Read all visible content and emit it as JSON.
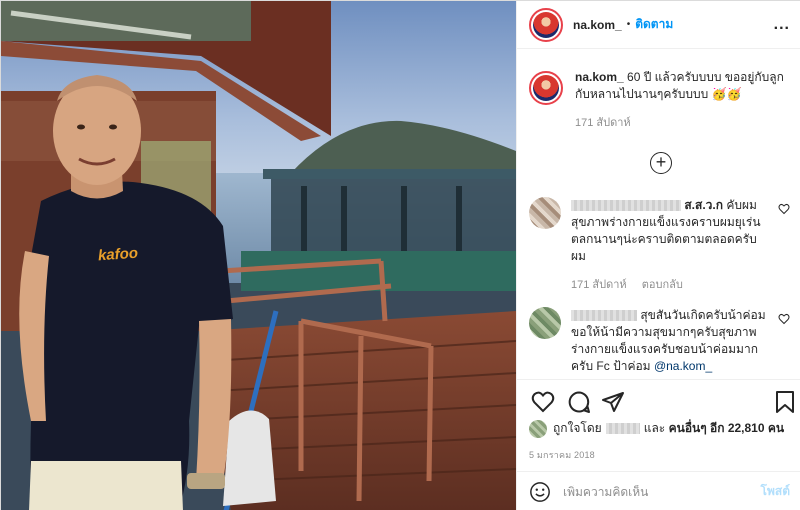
{
  "header": {
    "username": "na.kom_",
    "separator": "•",
    "follow_label": "ติดตาม",
    "more_label": "..."
  },
  "photo": {
    "shirt_logo_text": "kafoo"
  },
  "caption": {
    "username": "na.kom_",
    "text": "60 ปี แล้วครับบบบ ขออยู่กับลูกกับหลานไปนานๆครับบบบ 🥳🥳",
    "time": "171 สัปดาห์"
  },
  "load_more": {
    "icon": "plus-circle-icon",
    "label": "+"
  },
  "comments": [
    {
      "username": "ส.ส.ว.ก",
      "text": "คับผมสุขภาพร่างกายแข็งแรงคราบผมยุเร่นตลกนานๆน่ะคราบติดตามตลอดครับผม",
      "time": "171 สัปดาห์",
      "reply_label": "ตอบกลับ"
    },
    {
      "username": "",
      "text": "สุขสันวันเกิดครับน้าค่อมขอให้น้ามีความสุขมากๆครับสุขภาพร่างกายแข็งแรงครับชอบน้าค่อมมากครับ Fc ป้าค่อม",
      "mention": "@na.kom_"
    }
  ],
  "likes": {
    "liked_by_label": "ถูกใจโดย",
    "and_label": "และ",
    "others_label": "คนอื่นๆ อีก 22,810 คน"
  },
  "date": "5 มกราคม 2018",
  "add_comment": {
    "placeholder": "เพิ่มความคิดเห็น",
    "post_label": "โพสต์"
  },
  "colors": {
    "accent": "#0095f6",
    "post_disabled": "#b2dffc",
    "muted": "#8e8e8e",
    "text": "#262626"
  }
}
